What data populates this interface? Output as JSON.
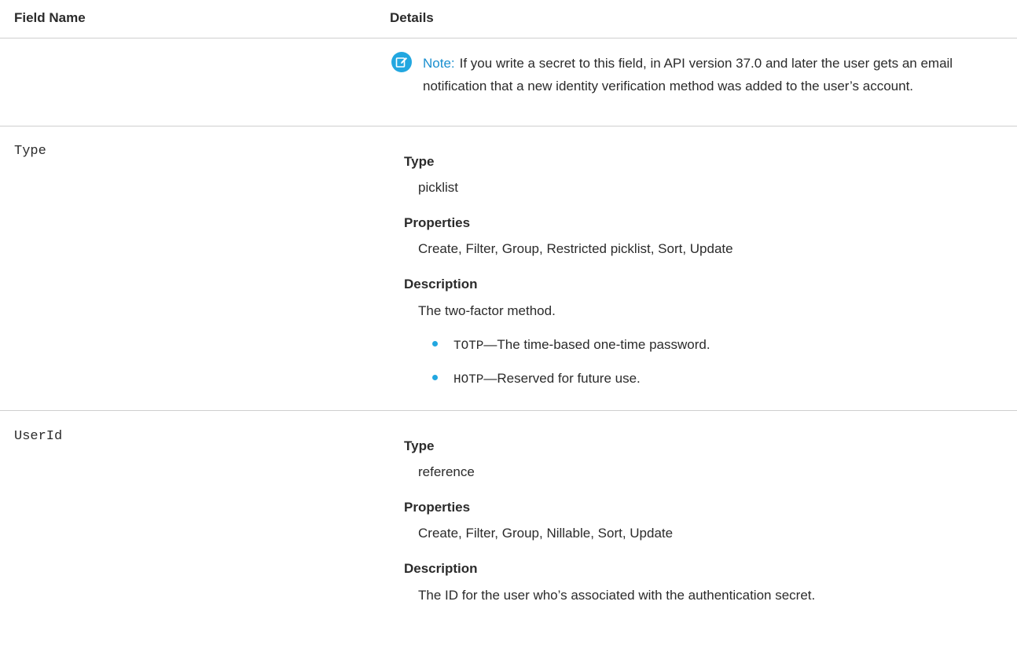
{
  "header": {
    "field_name": "Field Name",
    "details": "Details"
  },
  "note": {
    "label": "Note:",
    "text": "If you write a secret to this field, in API version 37.0 and later the user gets an email notification that a new identity verification method was added to the user’s account."
  },
  "fields": [
    {
      "name": "Type",
      "type_label": "Type",
      "type_value": "picklist",
      "properties_label": "Properties",
      "properties_value": "Create, Filter, Group, Restricted picklist, Sort, Update",
      "description_label": "Description",
      "description_value": "The two-factor method.",
      "bullets": [
        {
          "code": "TOTP",
          "text": "—The time-based one-time password."
        },
        {
          "code": "HOTP",
          "text": "—Reserved for future use."
        }
      ]
    },
    {
      "name": "UserId",
      "type_label": "Type",
      "type_value": "reference",
      "properties_label": "Properties",
      "properties_value": "Create, Filter, Group, Nillable, Sort, Update",
      "description_label": "Description",
      "description_value": "The ID for the user who’s associated with the authentication secret."
    }
  ],
  "colors": {
    "accent": "#22a7e0",
    "note_label": "#1a8fcf",
    "divider": "#cfcfcf",
    "text": "#2b2b2b"
  },
  "icons": {
    "note": "edit-note-icon",
    "bullet": "bullet-dot-icon"
  }
}
